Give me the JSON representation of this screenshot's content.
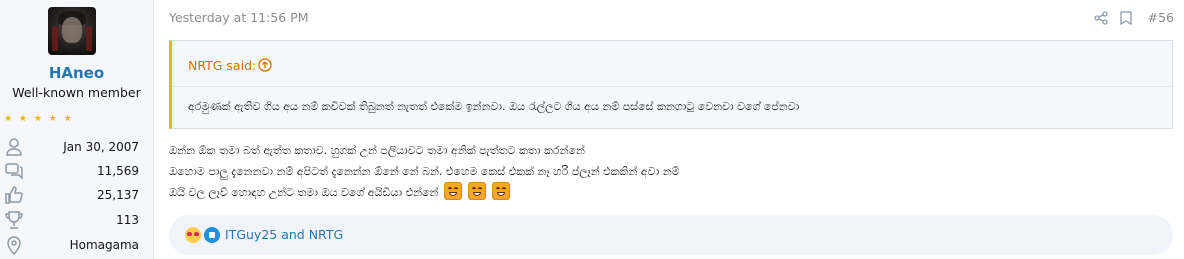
{
  "user": {
    "name": "HAneo",
    "title": "Well-known member",
    "stars": "★ ★ ★ ★ ★",
    "joined": "Jan 30, 2007",
    "messages": "11,569",
    "reactions": "25,137",
    "points": "113",
    "location": "Homagama"
  },
  "post": {
    "time": "Yesterday at 11:56 PM",
    "number": "#56",
    "quote": {
      "author": "NRTG said:",
      "text": "අරමුණක් ඇතිව ගිය අය නම් කවිවක් තිබුනත් නැතත් එකේම ඉන්නවා. ඔය රැල්ලට ගිය අය නම් පස්සේ කනගාටු වෙනවා වගේ පේනවා"
    },
    "lines": [
      "ඔන්න ඕක තමා බත් ඇත්ත කතාව. හුගක් උන් පලියාවට තමා අනික් පැත්තට කතා කරන්නේ",
      "ඔහොම පාලු දැනෙනවා නම් අපිටත් දැනෙන්න ඕනේ නේ බන්. එහෙම කෙස් එකක් නෑ හරි ප්ලෑන් එකකින් අවා නම්",
      "ඔයි වල ලෑව් හොඳහ උන්ට තමා ඔය වගේ අයිඩියා එන්නේ"
    ]
  },
  "reactions": {
    "names": "ITGuy25 and NRTG"
  },
  "icons": {
    "joined": "user-icon",
    "messages": "messages-icon",
    "reactions": "thumbs-up-icon",
    "points": "trophy-icon",
    "location": "location-pin-icon",
    "share": "share-icon",
    "bookmark": "bookmark-icon",
    "quote_jump": "arrow-up-circle-icon",
    "reaction_love": "love-emoji-icon",
    "reaction_like": "like-icon",
    "inline_emoji": "grin-emoji-icon"
  },
  "colors": {
    "accent": "#2577b1",
    "quote_author": "#d86f00",
    "quote_border": "#f0b400",
    "stars": "#f0b400"
  }
}
